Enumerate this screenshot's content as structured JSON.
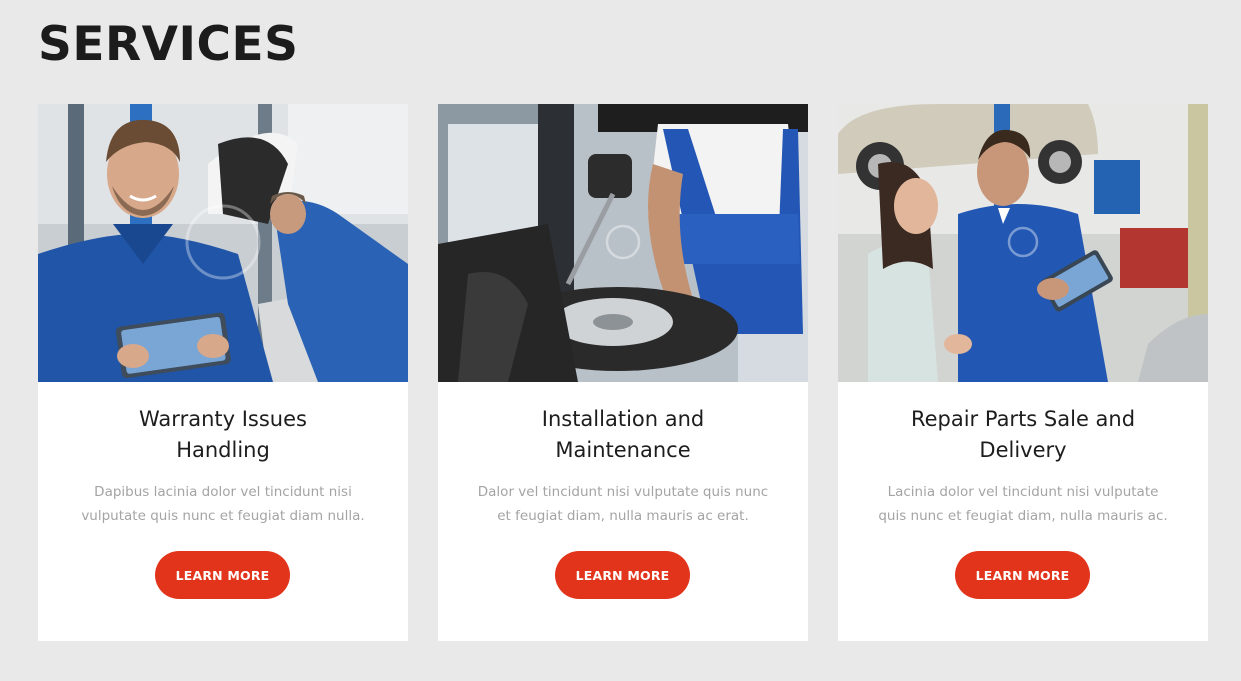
{
  "section": {
    "title": "SERVICES"
  },
  "cards": [
    {
      "title": "Warranty Issues Handling",
      "text": "Dapibus lacinia dolor vel tincidunt nisi vulputate quis nunc et feugiat diam nulla.",
      "button": "LEARN MORE"
    },
    {
      "title": "Installation and Maintenance",
      "text": "Dalor vel tincidunt nisi vulputate quis nunc et feugiat diam, nulla mauris ac erat.",
      "button": "LEARN MORE"
    },
    {
      "title": "Repair Parts Sale and Delivery",
      "text": "Lacinia dolor vel tincidunt nisi vulputate quis nunc et feugiat diam, nulla mauris ac.",
      "button": "LEARN MORE"
    }
  ],
  "colors": {
    "background": "#e9e9e9",
    "card": "#ffffff",
    "accent": "#e2341b",
    "title_text": "#1d1d1d",
    "body_text": "#a4a4a4",
    "uniform_blue": "#1f5fb8"
  }
}
